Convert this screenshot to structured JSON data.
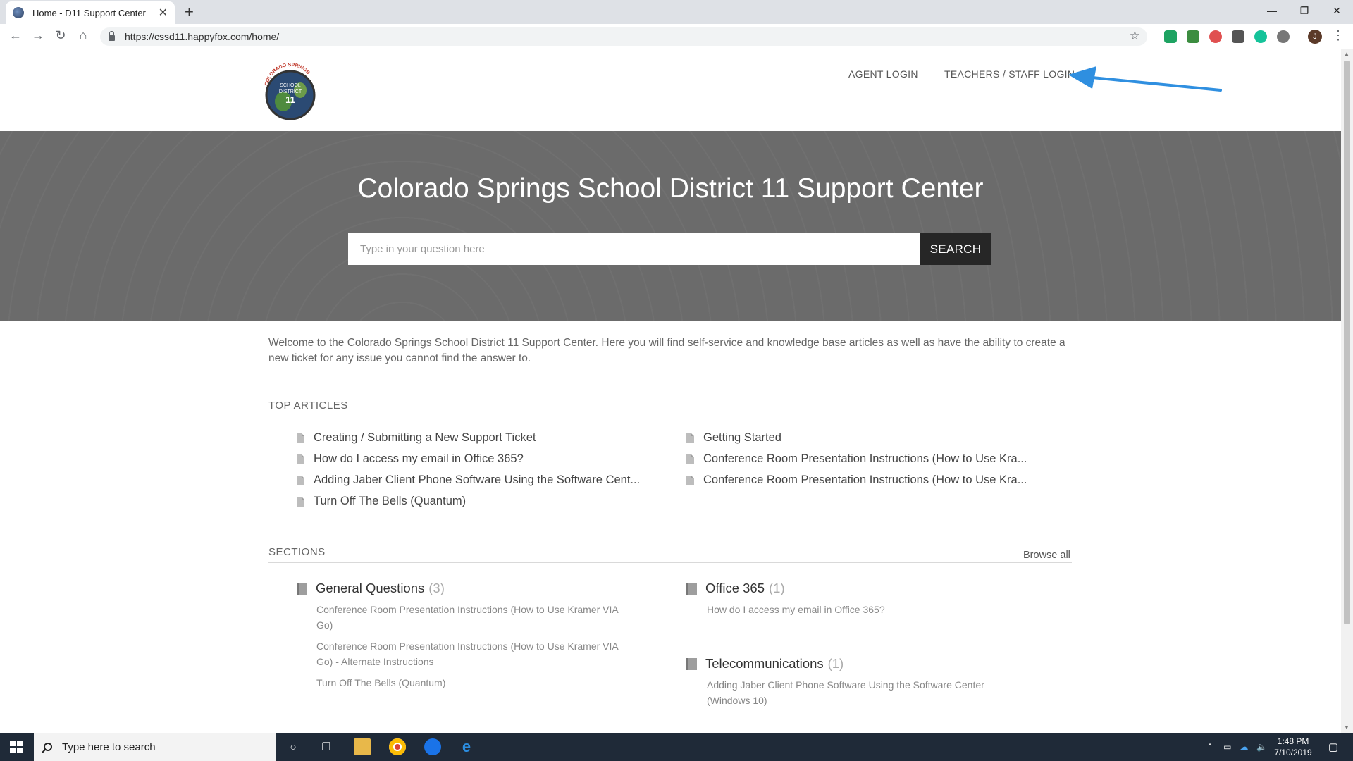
{
  "browser": {
    "tab_title": "Home - D11 Support Center",
    "tab_close": "✕",
    "new_tab": "+",
    "url": "https://cssd11.happyfox.com/home/",
    "window_controls": [
      "—",
      "❐",
      "✕"
    ],
    "profile_initial": "J"
  },
  "header": {
    "logo_alt_text": "COLORADO SPRINGS SCHOOL DISTRICT 11",
    "agent_login": "AGENT LOGIN",
    "staff_login": "TEACHERS / STAFF LOGIN",
    "annotation_color": "#2f8fe0"
  },
  "hero": {
    "title": "Colorado Springs School District 11 Support Center",
    "search_placeholder": "Type in your question here",
    "search_button": "SEARCH"
  },
  "welcome": "Welcome to the Colorado Springs School District 11 Support Center. Here you will find self-service and knowledge base articles as well as have the ability to create a new ticket for any issue you cannot find the answer to.",
  "top_articles": {
    "heading": "TOP ARTICLES",
    "left": [
      "Creating / Submitting a New Support Ticket",
      "How do I access my email in Office 365?",
      "Adding Jaber Client Phone Software Using the Software Cent...",
      "Turn Off The Bells (Quantum)"
    ],
    "right": [
      "Getting Started",
      "Conference Room Presentation Instructions (How to Use Kra...",
      "Conference Room Presentation Instructions (How to Use Kra..."
    ]
  },
  "sections": {
    "heading": "SECTIONS",
    "browse_all": "Browse all",
    "items": [
      {
        "title": "General Questions",
        "count": "(3)",
        "articles": [
          "Conference Room Presentation Instructions (How to Use Kramer VIA Go)",
          "Conference Room Presentation Instructions (How to Use Kramer VIA Go) - Alternate Instructions",
          "Turn Off The Bells (Quantum)"
        ]
      },
      {
        "title": "Office 365",
        "count": "(1)",
        "articles": [
          "How do I access my email in Office 365?"
        ]
      },
      {
        "title": "Telecommunications",
        "count": "(1)",
        "articles": [
          "Adding Jaber Client Phone Software Using the Software Center (Windows 10)"
        ]
      }
    ]
  },
  "taskbar": {
    "search_placeholder": "Type here to search",
    "time": "1:48 PM",
    "date": "7/10/2019"
  }
}
